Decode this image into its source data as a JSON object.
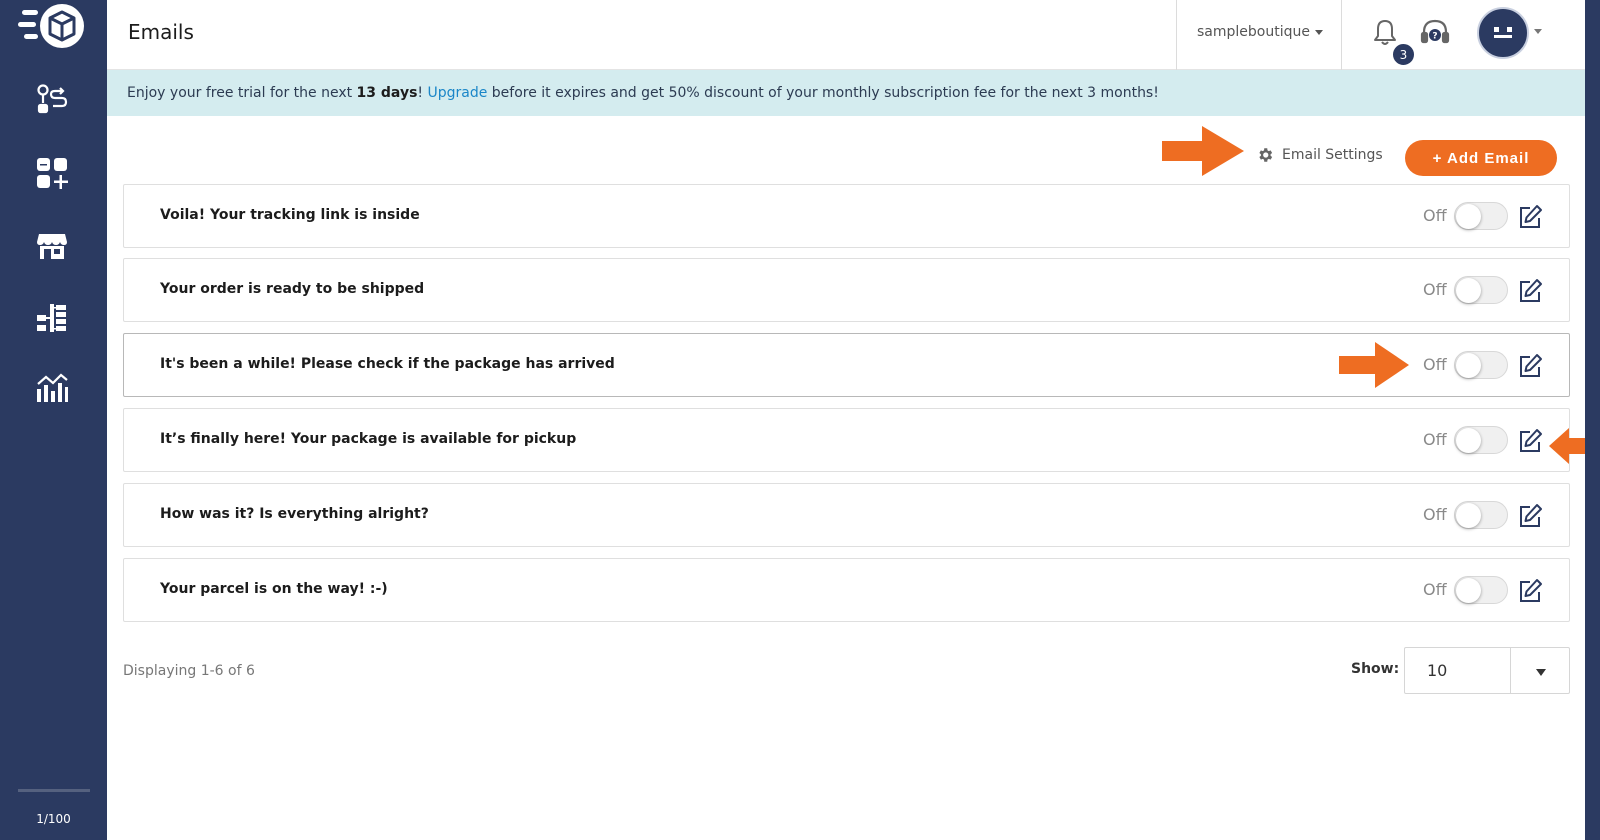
{
  "header": {
    "title": "Emails",
    "store_name": "sampleboutique",
    "notification_count": "3"
  },
  "banner": {
    "text_1": "Enjoy your free trial for the next ",
    "days": "13 days",
    "text_2": "! ",
    "link": "Upgrade",
    "text_3": " before it expires and get 50% discount of your monthly subscription fee for the next 3 months!"
  },
  "toolbar": {
    "settings_label": "Email Settings",
    "add_label": "+ Add Email"
  },
  "emails": [
    {
      "title": "Voila! Your tracking link is inside",
      "status": "Off"
    },
    {
      "title": "Your order is ready to be shipped",
      "status": "Off"
    },
    {
      "title": "It's been a while! Please check if the package has arrived",
      "status": "Off"
    },
    {
      "title": "It’s finally here! Your package is available for pickup",
      "status": "Off"
    },
    {
      "title": "How was it? Is everything alright?",
      "status": "Off"
    },
    {
      "title": "Your parcel is on the way! :-)",
      "status": "Off"
    }
  ],
  "footer": {
    "displaying": "Displaying 1-6 of 6",
    "show_label": "Show:",
    "show_value": "10"
  },
  "sidebar": {
    "usage": "1/100",
    "items": [
      "route-icon",
      "apps-add-icon",
      "store-icon",
      "hierarchy-icon",
      "analytics-icon"
    ]
  },
  "colors": {
    "sidebar": "#2b3a61",
    "accent": "#ee6d22",
    "banner": "#d4ecef",
    "link": "#1a86c8"
  }
}
